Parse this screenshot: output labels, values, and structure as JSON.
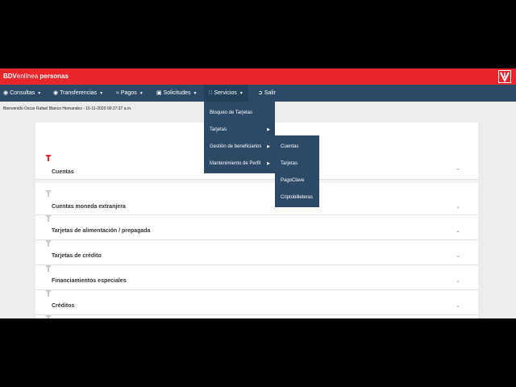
{
  "header": {
    "brand_bold": "BDV",
    "brand_thin": "enlínea",
    "brand_suffix": " personas",
    "logo_icon": "bdv-logo-icon"
  },
  "nav": {
    "items": [
      {
        "label": "Consultas",
        "icon": "globe-icon"
      },
      {
        "label": "Transferencias",
        "icon": "globe-icon"
      },
      {
        "label": "Pagos",
        "icon": "pay-icon"
      },
      {
        "label": "Solicitudes",
        "icon": "document-icon"
      },
      {
        "label": "Servicios",
        "icon": "grid-icon"
      },
      {
        "label": "Salir",
        "icon": "logout-icon"
      }
    ]
  },
  "welcome": "Bienvenido Oscar Rafael Blanco Hernandez - 16-11-2020 00:27:37 a.m.",
  "accordion": [
    {
      "label": "Cuentas",
      "expanded": true
    },
    {
      "label": "Cuentas moneda extranjera",
      "expanded": false
    },
    {
      "label": "Tarjetas de alimentación / prepagada",
      "expanded": false
    },
    {
      "label": "Tarjetas de crédito",
      "expanded": false
    },
    {
      "label": "Financiamientos especiales",
      "expanded": false
    },
    {
      "label": "Créditos",
      "expanded": false
    }
  ],
  "servicios_menu": {
    "items": [
      "Bloqueo de Tarjetas",
      "Tarjetas",
      "Gestión de beneficiarios",
      "Mantenimiento de Perfil"
    ]
  },
  "submenu": {
    "items": [
      "Cuentas",
      "Tarjetas",
      "PagoClave",
      "Criptobilleteras"
    ]
  },
  "colors": {
    "header_red": "#e8262c",
    "nav_blue": "#2c4a66",
    "flag_active": "#e8262c",
    "flag_inactive": "#c8c8c8"
  }
}
